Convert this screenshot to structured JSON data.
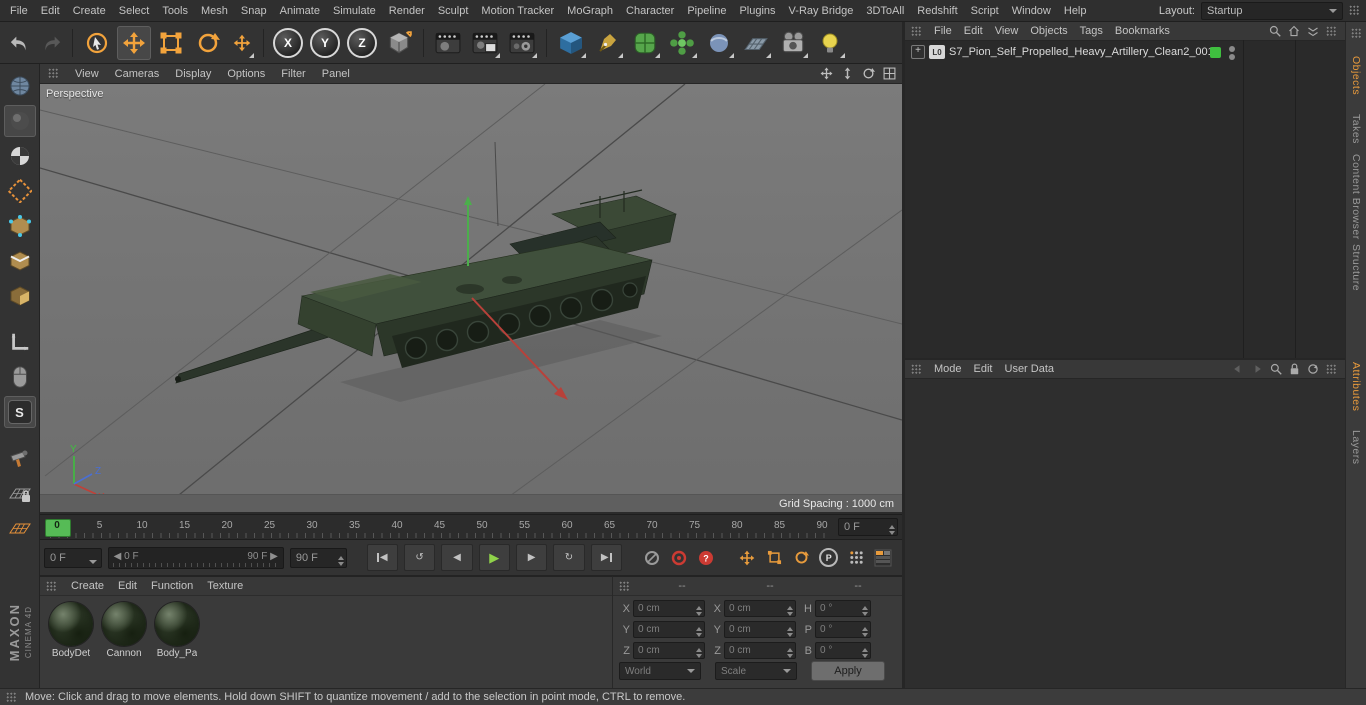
{
  "menubar": {
    "items": [
      "File",
      "Edit",
      "Create",
      "Select",
      "Tools",
      "Mesh",
      "Snap",
      "Animate",
      "Simulate",
      "Render",
      "Sculpt",
      "Motion Tracker",
      "MoGraph",
      "Character",
      "Pipeline",
      "Plugins",
      "V-Ray Bridge",
      "3DToAll",
      "Redshift",
      "Script",
      "Window",
      "Help"
    ],
    "layout_label": "Layout:",
    "layout_value": "Startup"
  },
  "main_toolbar": {
    "axis_locks": [
      "X",
      "Y",
      "Z"
    ]
  },
  "left_toolbar": {
    "snap_label": "S"
  },
  "viewport": {
    "menu": [
      "View",
      "Cameras",
      "Display",
      "Options",
      "Filter",
      "Panel"
    ],
    "view_label": "Perspective",
    "grid_spacing": "Grid Spacing : 1000 cm"
  },
  "timeline": {
    "ticks": [
      "0",
      "5",
      "10",
      "15",
      "20",
      "25",
      "30",
      "35",
      "40",
      "45",
      "50",
      "55",
      "60",
      "65",
      "70",
      "75",
      "80",
      "85",
      "90"
    ],
    "frame_field": "0 F"
  },
  "transport": {
    "start_frame": "0 F",
    "range_start": "0 F",
    "range_end": "90 F",
    "end_frame": "90 F",
    "record_parameter": "P"
  },
  "materials": {
    "menu": [
      "Create",
      "Edit",
      "Function",
      "Texture"
    ],
    "items": [
      {
        "label": "BodyDet"
      },
      {
        "label": "Cannon"
      },
      {
        "label": "Body_Pa"
      }
    ]
  },
  "coordinates": {
    "headers": [
      "--",
      "--",
      "--"
    ],
    "position": {
      "labels": [
        "X",
        "Y",
        "Z"
      ],
      "values": [
        "0 cm",
        "0 cm",
        "0 cm"
      ]
    },
    "size": {
      "labels": [
        "X",
        "Y",
        "Z"
      ],
      "values": [
        "0 cm",
        "0 cm",
        "0 cm"
      ]
    },
    "rotation": {
      "labels": [
        "H",
        "P",
        "B"
      ],
      "values": [
        "0 °",
        "0 °",
        "0 °"
      ]
    },
    "mode_left": "World",
    "mode_right": "Scale",
    "apply": "Apply"
  },
  "object_manager": {
    "menu": [
      "File",
      "Edit",
      "View",
      "Objects",
      "Tags",
      "Bookmarks"
    ],
    "object_name": "S7_Pion_Self_Propelled_Heavy_Artillery_Clean2_001",
    "object_icon_label": "L0"
  },
  "attribute_manager": {
    "menu": [
      "Mode",
      "Edit",
      "User Data"
    ]
  },
  "right_tabs": {
    "top": [
      "Objects",
      "Takes",
      "Content Browser",
      "Structure"
    ],
    "bottom": [
      "Attributes",
      "Layers"
    ]
  },
  "branding": {
    "line1": "MAXON",
    "line2": "CINEMA 4D"
  },
  "statusbar": {
    "text": "Move: Click and drag to move elements. Hold down SHIFT to quantize movement / add to the selection in point mode, CTRL to remove."
  }
}
